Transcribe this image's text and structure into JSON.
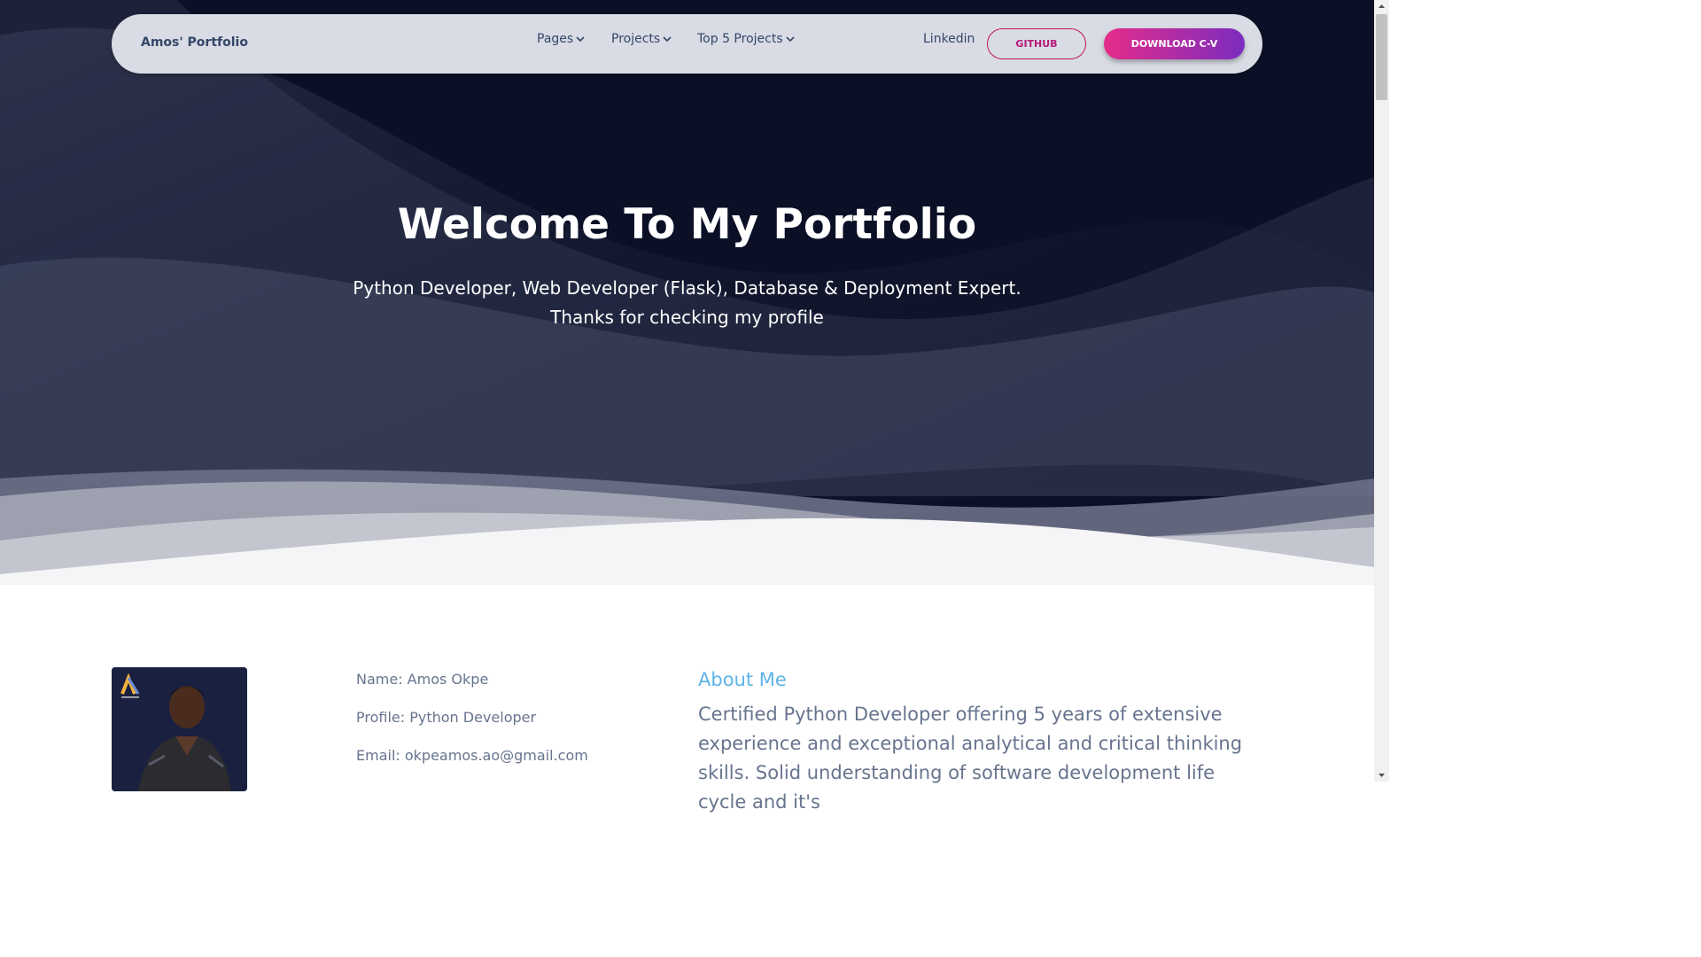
{
  "nav": {
    "brand": "Amos' Portfolio",
    "items": [
      {
        "label": "Pages"
      },
      {
        "label": "Projects"
      },
      {
        "label": "Top 5 Projects"
      }
    ],
    "linkedin": "Linkedin",
    "github": "GITHUB",
    "download_cv": "DOWNLOAD C-V"
  },
  "hero": {
    "title": "Welcome To My Portfolio",
    "subtitle_line1": "Python Developer, Web Developer (Flask), Database & Deployment Expert.",
    "subtitle_line2": "Thanks for checking my profile"
  },
  "profile": {
    "name": "Name: Amos Okpe",
    "role": "Profile: Python Developer",
    "email": "Email: okpeamos.ao@gmail.com"
  },
  "about": {
    "title": "About Me",
    "text": "Certified Python Developer offering 5 years of extensive experience and exceptional analytical and critical thinking skills. Solid understanding of software development life cycle and it's"
  },
  "colors": {
    "hero_bg": "#0b1026",
    "accent_pink": "#e52c8a",
    "accent_purple": "#7b2cbf",
    "about_title": "#5eb4e8"
  }
}
